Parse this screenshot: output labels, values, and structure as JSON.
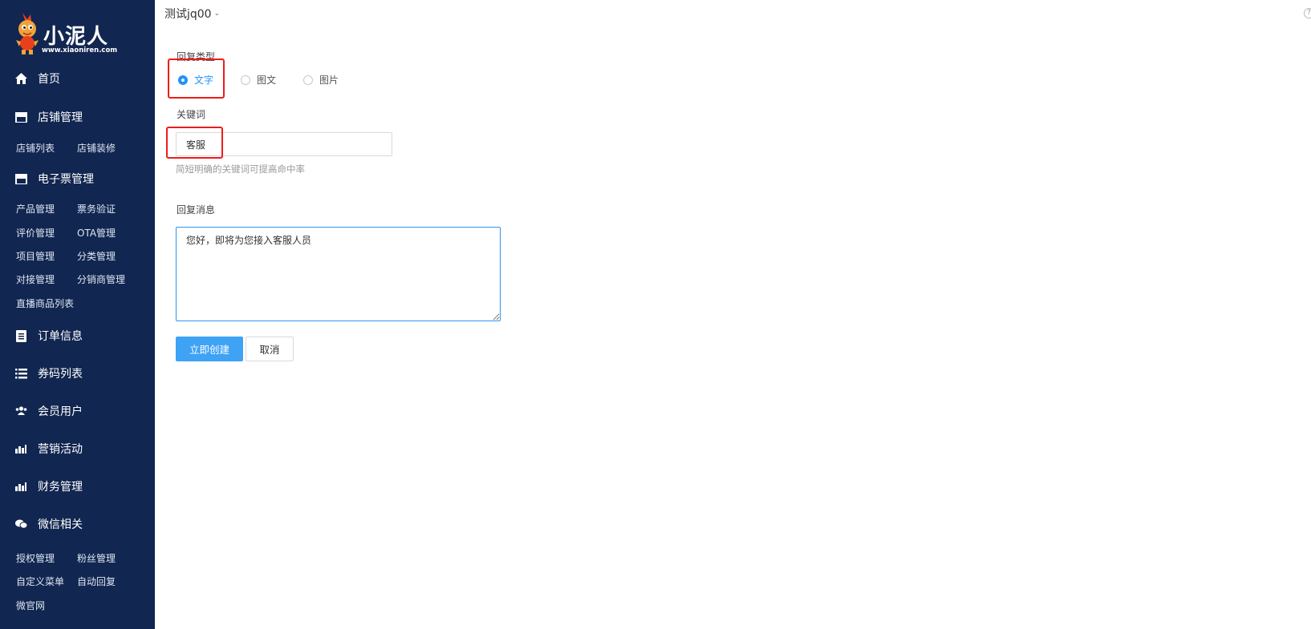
{
  "brand": {
    "name": "小泥人",
    "url": "www.xiaoniren.com"
  },
  "sidebar": {
    "menus": [
      {
        "label": "首页",
        "icon": "home-icon"
      },
      {
        "label": "店铺管理",
        "icon": "store-icon",
        "children": [
          "店铺列表",
          "店铺装修"
        ]
      },
      {
        "label": "电子票管理",
        "icon": "ticket-icon",
        "children": [
          "产品管理",
          "票务验证",
          "评价管理",
          "OTA管理",
          "项目管理",
          "分类管理",
          "对接管理",
          "分销商管理",
          "直播商品列表"
        ]
      },
      {
        "label": "订单信息",
        "icon": "document-icon"
      },
      {
        "label": "券码列表",
        "icon": "list-icon"
      },
      {
        "label": "会员用户",
        "icon": "users-icon"
      },
      {
        "label": "营销活动",
        "icon": "bar-chart-icon"
      },
      {
        "label": "财务管理",
        "icon": "bar-chart-icon"
      },
      {
        "label": "微信相关",
        "icon": "wechat-icon",
        "children": [
          "授权管理",
          "粉丝管理",
          "自定义菜单",
          "自动回复",
          "微官网"
        ]
      }
    ]
  },
  "header": {
    "account": "测试jq00",
    "help": "?"
  },
  "form": {
    "reply_type_label": "回复类型",
    "reply_types": [
      "文字",
      "图文",
      "图片"
    ],
    "reply_type_selected": "文字",
    "keyword_label": "关键词",
    "keyword_value": "客服",
    "keyword_hint": "简短明确的关键词可提高命中率",
    "reply_message_label": "回复消息",
    "reply_message_value": "您好，即将为您接入客服人员",
    "submit_label": "立即创建",
    "cancel_label": "取消"
  },
  "colors": {
    "sidebar_bg": "#112650",
    "accent": "#3ea2f5",
    "highlight_box": "#ee1c1c"
  }
}
